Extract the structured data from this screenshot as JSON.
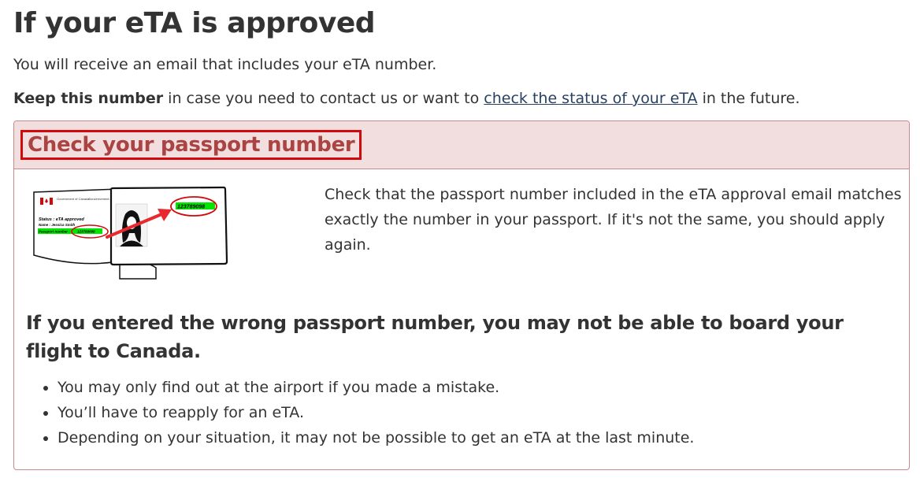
{
  "page": {
    "title": "If your eTA is approved",
    "intro": "You will receive an email that includes your eTA number.",
    "keep_strong": "Keep this number",
    "keep_before_link": " in case you need to contact us or want to ",
    "keep_link": "check the status of your eTA",
    "keep_after_link": " in the future."
  },
  "panel": {
    "title": "Check your passport number",
    "body": "Check that the passport number included in the eTA approval email matches exactly the number in your passport. If it's not the same, you should apply again.",
    "warning": "If you entered the wrong passport number, you may not be able to board your flight to Canada.",
    "bullets": [
      "You may only find out at the airport if you made a mistake.",
      "You’ll have to reapply for an eTA.",
      "Depending on your situation, it may not be possible to get an eTA at the last minute."
    ]
  },
  "illustration": {
    "gov_en": "Government of Canada",
    "gov_fr": "Gouvernement du Canada",
    "status_line": "Status : eTA approved",
    "name_line": "Name : Jessica Smith",
    "passport_label": "Passport number : ",
    "passport_number": "123789098",
    "highlight_color": "#00e600",
    "circle_color": "#d3080c",
    "arrow_color": "#e8292d"
  },
  "colors": {
    "link": "#284162",
    "panel_title": "#a94442",
    "panel_heading_bg": "#f2dede",
    "highlight_border": "#d3080c"
  }
}
